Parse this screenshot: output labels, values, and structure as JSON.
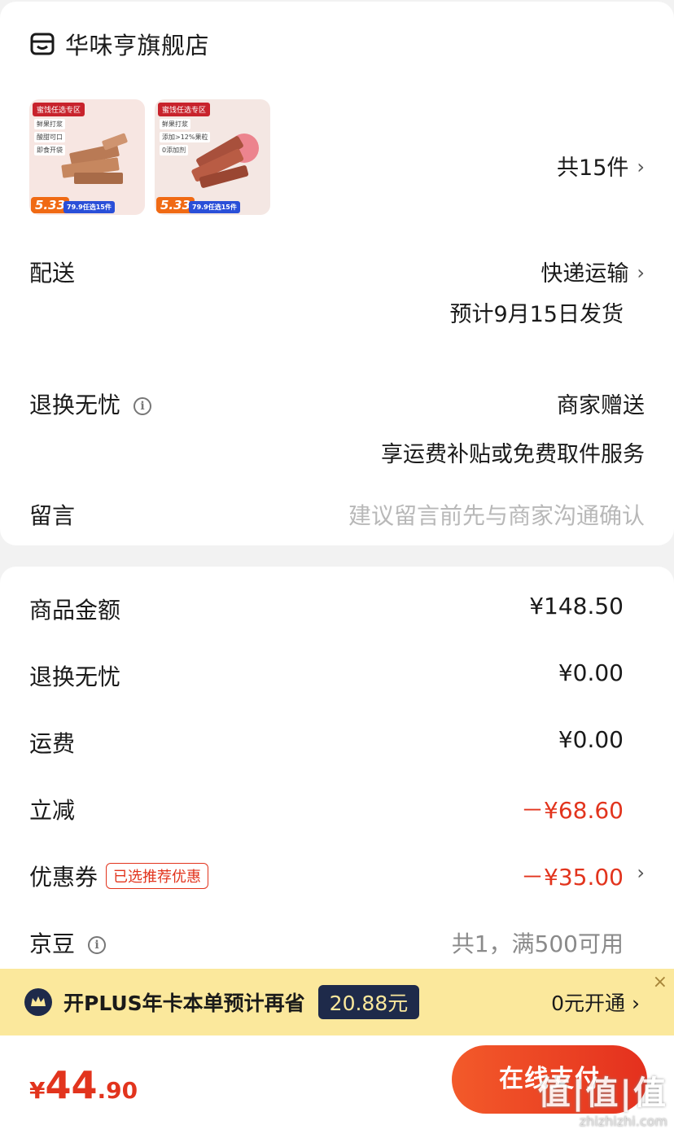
{
  "store": {
    "name": "华味亨旗舰店",
    "icon": "store-icon"
  },
  "products": [
    {
      "tag": "蜜饯任选专区",
      "features": [
        "鲜果打浆",
        "酸甜可口",
        "即食开袋"
      ],
      "badge_price": "5.33",
      "deal": "79.9任选15件"
    },
    {
      "tag": "蜜饯任选专区",
      "features": [
        "鲜果打浆",
        "添加>12%果粒",
        "0添加剂"
      ],
      "badge_price": "5.33",
      "deal": "79.9任选15件"
    }
  ],
  "items_count": "共15件",
  "delivery": {
    "label": "配送",
    "method": "快递运输",
    "eta": "预计9月15日发货"
  },
  "return_worry": {
    "label": "退换无忧",
    "value": "商家赠送",
    "desc": "享运费补贴或免费取件服务"
  },
  "message": {
    "label": "留言",
    "placeholder": "建议留言前先与商家沟通确认"
  },
  "prices": {
    "goods": {
      "label": "商品金额",
      "value": "¥148.50"
    },
    "return_fee": {
      "label": "退换无忧",
      "value": "¥0.00"
    },
    "shipping": {
      "label": "运费",
      "value": "¥0.00"
    },
    "discount": {
      "label": "立减",
      "value": "－¥68.60"
    },
    "coupon": {
      "label": "优惠券",
      "badge": "已选推荐优惠",
      "value": "－¥35.00"
    },
    "jingdou": {
      "label": "京豆",
      "value": "共1，满500可用"
    }
  },
  "plus": {
    "text": "开PLUS年卡本单预计再省",
    "amount": "20.88元",
    "open": "0元开通",
    "close": "×"
  },
  "total": {
    "symbol": "¥",
    "integer": "44",
    "decimal": ".90"
  },
  "pay_button": "在线支付",
  "watermark": {
    "logo": "值|值|值",
    "domain": "zhizhizhi.com"
  },
  "colors": {
    "accent": "#e2341d",
    "plus_bg": "#fbe89c",
    "plus_dark": "#1e2a4a"
  }
}
